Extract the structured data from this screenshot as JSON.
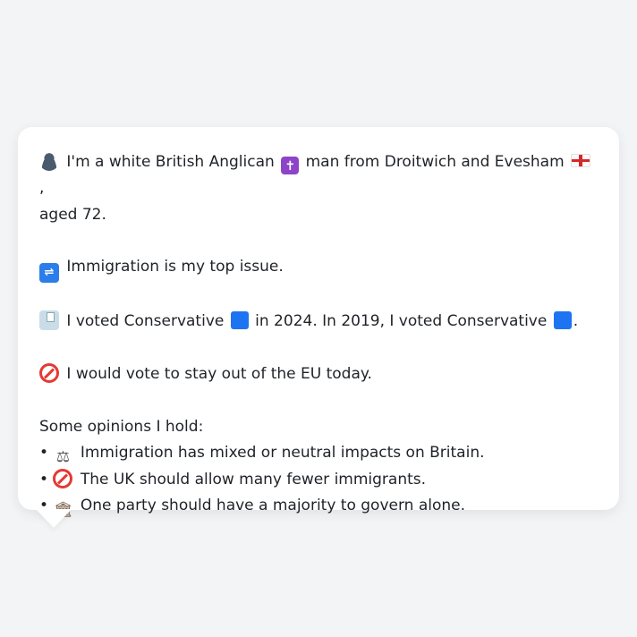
{
  "profile": {
    "intro_a": "I'm a white British Anglican",
    "intro_b": "man from Droitwich and Evesham",
    "intro_c": ",",
    "intro_d": "aged 72.",
    "top_issue": "Immigration is my top issue.",
    "vote_a": "I voted Conservative",
    "vote_b": "in 2024. In 2019, I voted Conservative",
    "vote_c": ".",
    "eu": "I would vote to stay out of the EU today.",
    "opinions_heading": "Some opinions I hold:",
    "opinions": [
      "Immigration has mixed or neutral impacts on Britain.",
      "The UK should allow many fewer immigrants.",
      "One party should have a majority to govern alone."
    ]
  },
  "icons": {
    "person": "person-silhouette-icon",
    "religion": "latin-cross-icon",
    "flag": "england-flag-icon",
    "immigration": "passport-control-icon",
    "ballot": "ballot-box-icon",
    "party": "blue-square-icon",
    "no": "no-entry-icon",
    "scales": "balance-scale-icon",
    "government": "classical-building-icon"
  },
  "colors": {
    "background": "#f3f4f6",
    "card": "#ffffff",
    "text": "#1f2328",
    "party_blue": "#1d74f2",
    "no_red": "#e53935"
  }
}
